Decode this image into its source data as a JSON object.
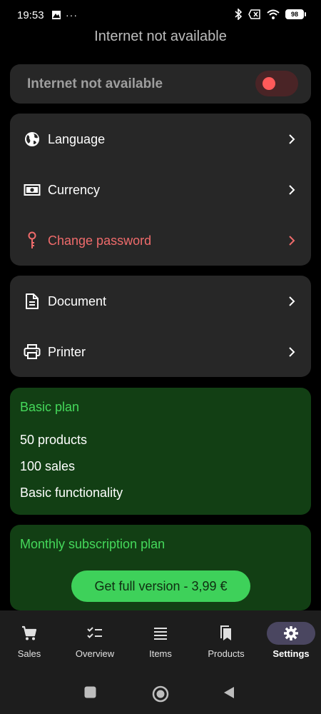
{
  "status_bar": {
    "time": "19:53",
    "battery": "98",
    "left_icons": [
      "photo-icon",
      "more-dots-icon"
    ],
    "right_icons": [
      "bluetooth-icon",
      "sim-icon",
      "wifi-icon",
      "battery-icon"
    ]
  },
  "banner": {
    "text": "Internet not available"
  },
  "connectivity": {
    "label": "Internet not available",
    "toggle_on": false
  },
  "settings_group_1": [
    {
      "label": "Language",
      "icon": "globe-icon"
    },
    {
      "label": "Currency",
      "icon": "money-icon"
    },
    {
      "label": "Change password",
      "icon": "key-icon"
    }
  ],
  "settings_group_2": [
    {
      "label": "Document",
      "icon": "document-icon"
    },
    {
      "label": "Printer",
      "icon": "printer-icon"
    }
  ],
  "basic_plan": {
    "title": "Basic plan",
    "features": [
      "50 products",
      "100 sales",
      "Basic functionality"
    ]
  },
  "monthly_plan": {
    "title": "Monthly subscription plan",
    "button_label": "Get full version - 3,99 €"
  },
  "bottom_nav": [
    {
      "label": "Sales",
      "icon": "cart-icon"
    },
    {
      "label": "Overview",
      "icon": "checklist-icon"
    },
    {
      "label": "Items",
      "icon": "list-icon"
    },
    {
      "label": "Products",
      "icon": "bookmarks-icon"
    },
    {
      "label": "Settings",
      "icon": "gear-icon",
      "active": true
    }
  ],
  "colors": {
    "background": "#000000",
    "card": "#272727",
    "plan_card": "#123f14",
    "plan_accent": "#45d95b",
    "danger": "#ef6b6b",
    "nav_active": "#4a4660"
  }
}
